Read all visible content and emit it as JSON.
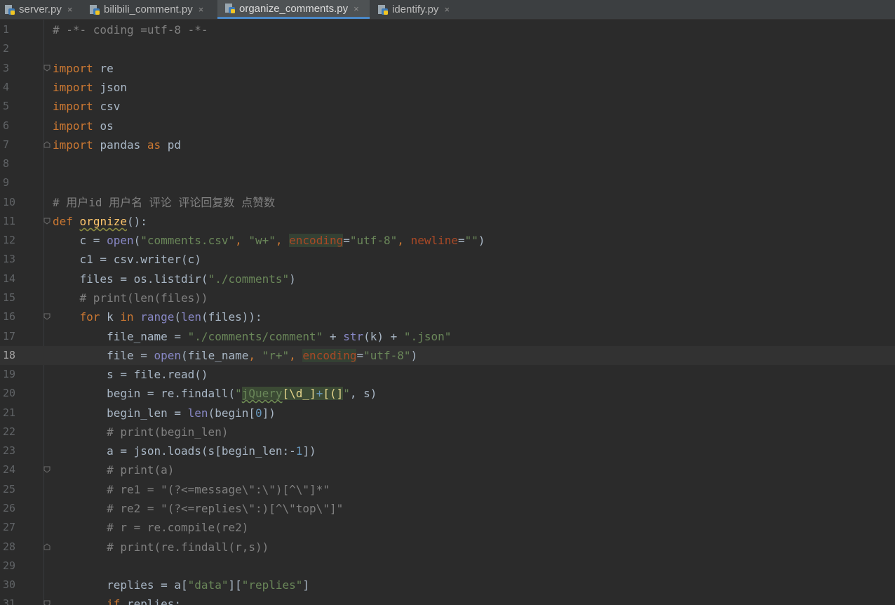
{
  "tabs": [
    {
      "label": "server.py",
      "icon": "python-file-icon",
      "active": false
    },
    {
      "label": "bilibili_comment.py",
      "icon": "python-file-icon",
      "active": false
    },
    {
      "label": "organize_comments.py",
      "icon": "python-file-icon",
      "active": true
    },
    {
      "label": "identify.py",
      "icon": "python-file-icon",
      "active": false
    }
  ],
  "tab_close_glyph": "×",
  "current_line": 18,
  "colors": {
    "background": "#2b2b2b",
    "keyword": "#cc7832",
    "string": "#6a8759",
    "comment": "#808080",
    "builtin": "#8888c6",
    "number": "#6897bb",
    "param": "#aa4926",
    "function": "#ffc66d",
    "tab_active_underline": "#4a88c7"
  },
  "code": {
    "line_numbers": [
      "1",
      "2",
      "3",
      "4",
      "5",
      "6",
      "7",
      "8",
      "9",
      "10",
      "11",
      "12",
      "13",
      "14",
      "15",
      "16",
      "17",
      "18",
      "19",
      "20",
      "21",
      "22",
      "23",
      "24",
      "25",
      "26",
      "27",
      "28",
      "29",
      "30",
      "31"
    ],
    "l1_comment": "# -*- coding =utf-8 -*-",
    "kw_import": "import",
    "kw_as": "as",
    "kw_def": "def",
    "kw_for": "for",
    "kw_in": "in",
    "kw_if": "if",
    "mod_re": "re",
    "mod_json": "json",
    "mod_csv": "csv",
    "mod_os": "os",
    "mod_pandas": "pandas",
    "alias_pd": "pd",
    "l10_comment": "# 用户id 用户名 评论 评论回复数 点赞数",
    "fn_name": "orgnize",
    "fn_tail": "():",
    "l12": {
      "a": "c = ",
      "open": "open",
      "b": "(",
      "s1": "\"comments.csv\"",
      "comma1": ", ",
      "s2": "\"w+\"",
      "comma2": ", ",
      "p1": "encoding",
      "eq1": "=",
      "s3": "\"utf-8\"",
      "comma3": ", ",
      "p2": "newline",
      "eq2": "=",
      "s4": "\"\"",
      "close": ")"
    },
    "l13": "c1 = csv.writer(c)",
    "l14": {
      "a": "files = os.listdir(",
      "s": "\"./comments\"",
      "b": ")"
    },
    "l15_comment": "# print(len(files))",
    "l16": {
      "a": " k ",
      "b": " ",
      "range": "range",
      "c": "(",
      "len": "len",
      "d": "(files)):"
    },
    "l17": {
      "a": "file_name = ",
      "s1": "\"./comments/comment\"",
      "b": " + ",
      "str": "str",
      "c": "(k) + ",
      "s2": "\".json\""
    },
    "l18": {
      "a": "file = ",
      "open": "open",
      "b": "(file_name",
      "comma1": ", ",
      "s1": "\"r+\"",
      "comma2": ", ",
      "p": "encoding",
      "eq": "=",
      "s2": "\"utf-8\"",
      "close": ")"
    },
    "l19": "s = file.read()",
    "l20": {
      "a": "begin = re.findall(",
      "q1": "\"",
      "r1": "jQuery",
      "r2": "[\\d_]",
      "r3": "+",
      "r4": "[(]",
      "q2": "\"",
      "b": ", s)"
    },
    "l21": {
      "a": "begin_len = ",
      "len": "len",
      "b": "(begin[",
      "n": "0",
      "c": "])"
    },
    "l22_comment": "# print(begin_len)",
    "l23": {
      "a": "a = json.loads(s[begin_len:-",
      "n": "1",
      "b": "])"
    },
    "l24_comment": "# print(a)",
    "l25_comment": "# re1 = \"(?<=message\\\":\\\")[^\\\"]*\"",
    "l26_comment": "# re2 = \"(?<=replies\\\":)[^\\\"top\\\"]\"",
    "l27_comment": "# r = re.compile(re2)",
    "l28_comment": "# print(re.findall(r,s))",
    "l30": {
      "a": "replies = a[",
      "s1": "\"data\"",
      "b": "][",
      "s2": "\"replies\"",
      "c": "]"
    },
    "l31": " replies:"
  }
}
